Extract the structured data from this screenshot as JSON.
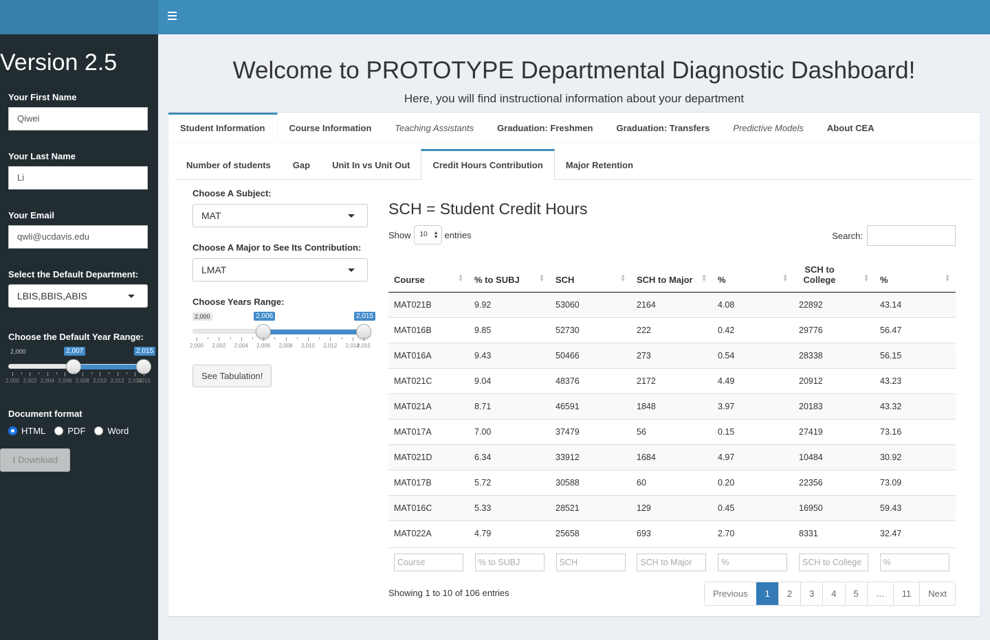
{
  "header": {
    "menu_icon": "hamburger-icon"
  },
  "sidebar": {
    "version": "Version 2.5",
    "first_name_label": "Your First Name",
    "first_name_value": "Qiwei",
    "last_name_label": "Your Last Name",
    "last_name_value": "Li",
    "email_label": "Your Email",
    "email_value": "qwli@ucdavis.edu",
    "department_label": "Select the Default Department:",
    "department_value": "LBIS,BBIS,ABIS",
    "year_range_label": "Choose the Default Year Range:",
    "year_slider": {
      "min_label": "2,000",
      "from_label": "2,007",
      "to_label": "2,015",
      "min": 2000,
      "max": 2015,
      "from": 2007,
      "to": 2015,
      "tick_labels": [
        "2,000",
        "2,002",
        "2,004",
        "2,006",
        "2,008",
        "2,010",
        "2,012",
        "2,014",
        "2,015"
      ]
    },
    "doc_format_label": "Document format",
    "formats": [
      "HTML",
      "PDF",
      "Word"
    ],
    "selected_format": "HTML",
    "download_label": "Download",
    "download_icon": "download-icon"
  },
  "main": {
    "title": "Welcome to PROTOTYPE Departmental Diagnostic Dashboard!",
    "subtitle": "Here, you will find instructional information about your department",
    "tabs": [
      "Student Information",
      "Course Information",
      "Teaching Assistants",
      "Graduation: Freshmen",
      "Graduation: Transfers",
      "Predictive Models",
      "About CEA"
    ],
    "subtabs": [
      "Number of students",
      "Gap",
      "Unit In vs Unit Out",
      "Credit Hours Contribution",
      "Major Retention"
    ],
    "subject_label": "Choose A Subject:",
    "subject_value": "MAT",
    "major_label": "Choose A Major to See Its Contribution:",
    "major_value": "LMAT",
    "years_label": "Choose Years Range:",
    "years_slider": {
      "min_label": "2,000",
      "from_label": "2,006",
      "to_label": "2,015",
      "min": 2000,
      "max": 2015,
      "from": 2006,
      "to": 2015,
      "tick_labels": [
        "2,000",
        "2,002",
        "2,004",
        "2,006",
        "2,008",
        "2,010",
        "2,012",
        "2,014",
        "2,015"
      ]
    },
    "tabulation_button": "See Tabulation!",
    "table_title": "SCH = Student Credit Hours",
    "show_label": "Show",
    "entries_value": "10",
    "entries_label": "entries",
    "search_label": "Search:",
    "columns": [
      "Course",
      "% to SUBJ",
      "SCH",
      "SCH to Major",
      "%",
      "SCH to College",
      "%"
    ],
    "rows": [
      [
        "MAT021B",
        "9.92",
        "53060",
        "2164",
        "4.08",
        "22892",
        "43.14"
      ],
      [
        "MAT016B",
        "9.85",
        "52730",
        "222",
        "0.42",
        "29776",
        "56.47"
      ],
      [
        "MAT016A",
        "9.43",
        "50466",
        "273",
        "0.54",
        "28338",
        "56.15"
      ],
      [
        "MAT021C",
        "9.04",
        "48376",
        "2172",
        "4.49",
        "20912",
        "43.23"
      ],
      [
        "MAT021A",
        "8.71",
        "46591",
        "1848",
        "3.97",
        "20183",
        "43.32"
      ],
      [
        "MAT017A",
        "7.00",
        "37479",
        "56",
        "0.15",
        "27419",
        "73.16"
      ],
      [
        "MAT021D",
        "6.34",
        "33912",
        "1684",
        "4.97",
        "10484",
        "30.92"
      ],
      [
        "MAT017B",
        "5.72",
        "30588",
        "60",
        "0.20",
        "22356",
        "73.09"
      ],
      [
        "MAT016C",
        "5.33",
        "28521",
        "129",
        "0.45",
        "16950",
        "59.43"
      ],
      [
        "MAT022A",
        "4.79",
        "25658",
        "693",
        "2.70",
        "8331",
        "32.47"
      ]
    ],
    "filter_placeholders": [
      "Course",
      "% to SUBJ",
      "SCH",
      "SCH to Major",
      "%",
      "SCH to College",
      "%"
    ],
    "showing_text": "Showing 1 to 10 of 106 entries",
    "pagination": [
      "Previous",
      "1",
      "2",
      "3",
      "4",
      "5",
      "…",
      "11",
      "Next"
    ],
    "active_page": "1"
  },
  "colors": {
    "header": "#3c8dbc",
    "sidebar": "#222d32",
    "accent": "#428bca"
  }
}
